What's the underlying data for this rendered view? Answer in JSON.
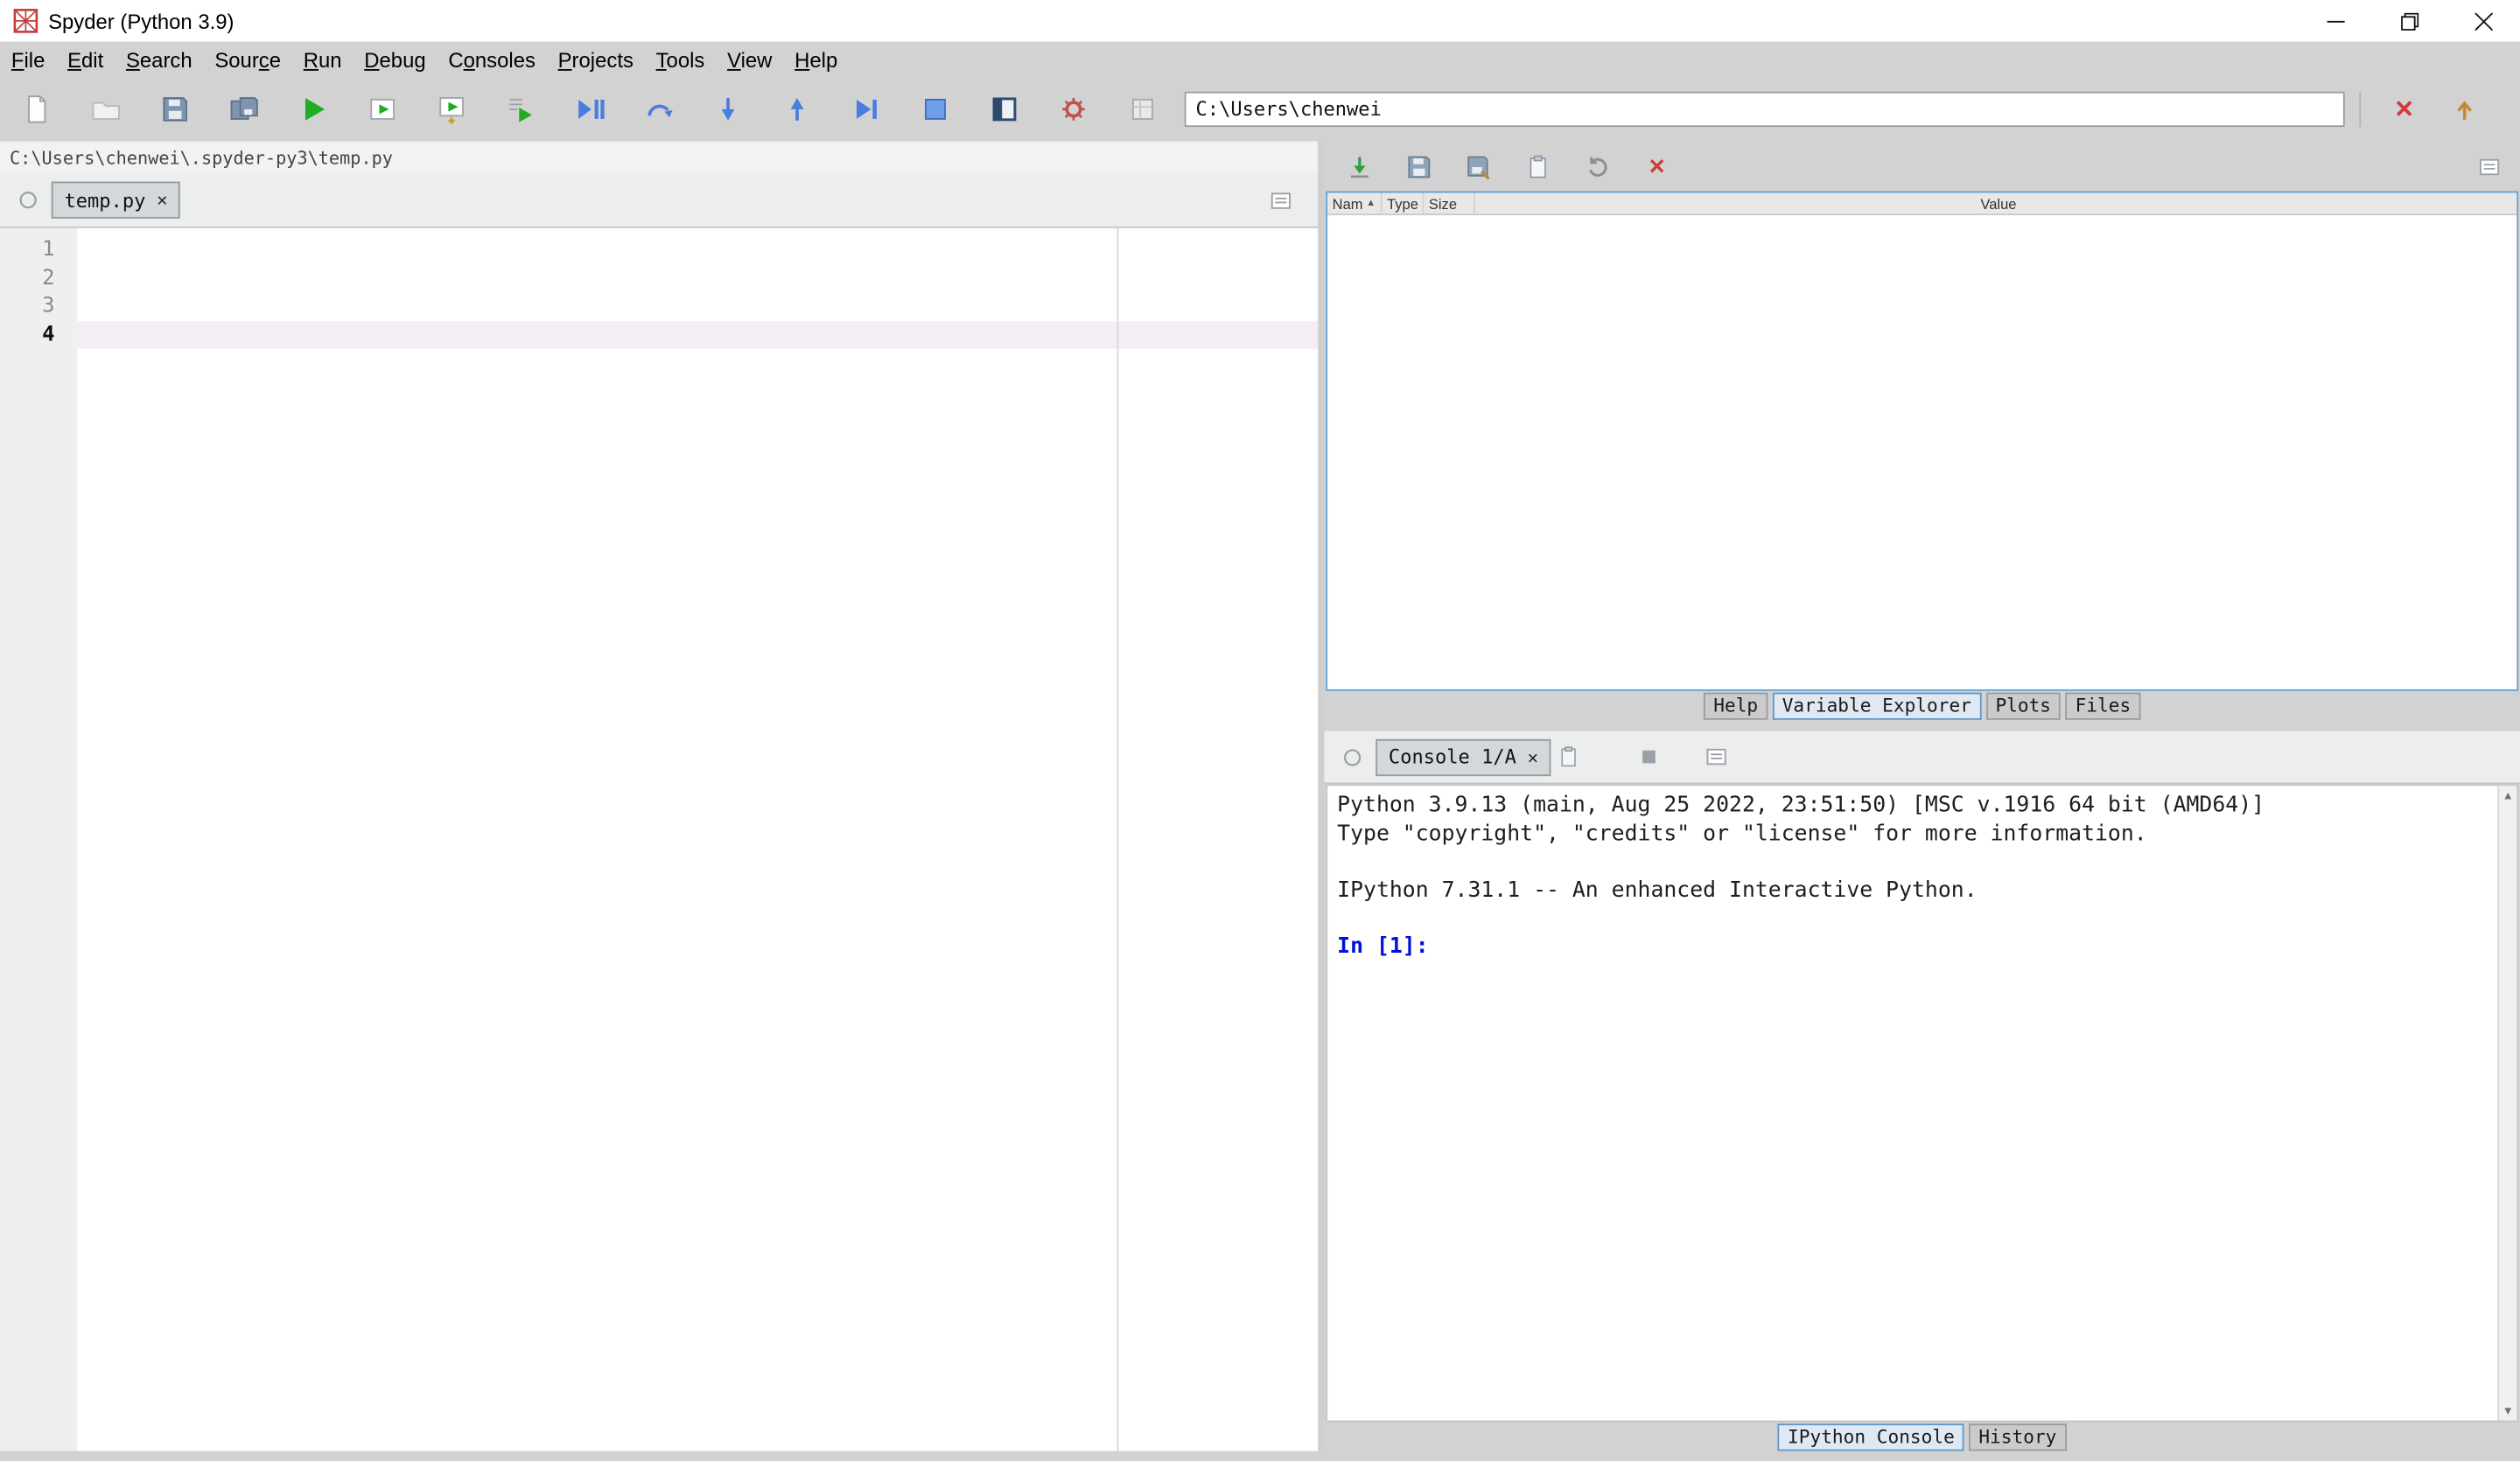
{
  "window": {
    "title": "Spyder (Python 3.9)"
  },
  "menu": {
    "items": [
      {
        "label": "&File"
      },
      {
        "label": "&Edit"
      },
      {
        "label": "&Search"
      },
      {
        "label": "Sour&ce"
      },
      {
        "label": "&Run"
      },
      {
        "label": "&Debug"
      },
      {
        "label": "C&onsoles"
      },
      {
        "label": "&Projects"
      },
      {
        "label": "&Tools"
      },
      {
        "label": "&View"
      },
      {
        "label": "&Help"
      }
    ]
  },
  "toolbar": {
    "working_directory": "C:\\Users\\chenwei",
    "icons": [
      "new-file-icon",
      "open-file-icon",
      "save-file-icon",
      "save-all-icon",
      "run-icon",
      "run-cell-icon",
      "run-cell-advance-icon",
      "run-selection-icon",
      "debug-icon",
      "step-over-icon",
      "step-into-icon",
      "step-out-icon",
      "continue-icon",
      "stop-icon",
      "maximize-pane-icon",
      "preferences-icon",
      "environment-icon",
      "browse-directory-icon",
      "parent-directory-icon"
    ]
  },
  "editor": {
    "breadcrumb": "C:\\Users\\chenwei\\.spyder-py3\\temp.py",
    "tab": {
      "label": "temp.py",
      "close_glyph": "✕"
    },
    "line_numbers": [
      "1",
      "2",
      "3",
      "4"
    ],
    "current_line": "4"
  },
  "variable_explorer": {
    "toolbar_icons": [
      "import-data-icon",
      "save-data-icon",
      "save-data-as-icon",
      "clipboard-icon",
      "refresh-icon",
      "remove-variable-icon",
      "options-menu-icon"
    ],
    "columns": {
      "name": "Nam",
      "sort_glyph": "▲",
      "type": "Type",
      "size": "Size",
      "value": "Value"
    },
    "tabs": [
      {
        "label": "Help",
        "selected": false
      },
      {
        "label": "Variable Explorer",
        "selected": true
      },
      {
        "label": "Plots",
        "selected": false
      },
      {
        "label": "Files",
        "selected": false
      }
    ]
  },
  "console": {
    "tab": {
      "label": "Console 1/A",
      "close_glyph": "✕"
    },
    "toolbar_icons": [
      "clipboard-icon",
      "interrupt-kernel-icon",
      "options-menu-icon"
    ],
    "lines": [
      "Python 3.9.13 (main, Aug 25 2022, 23:51:50) [MSC v.1916 64 bit (AMD64)]",
      "Type \"copyright\", \"credits\" or \"license\" for more information.",
      "",
      "IPython 7.31.1 -- An enhanced Interactive Python.",
      ""
    ],
    "prompt": "In [1]:",
    "tabs": [
      {
        "label": "IPython Console",
        "selected": true
      },
      {
        "label": "History",
        "selected": false
      }
    ]
  },
  "colors": {
    "window_chrome": "#d2d2d2",
    "titlebar_bg": "#ffffff",
    "focus_border_blue": "#5b9fd4",
    "run_green": "#21ac21",
    "debug_blue": "#4a7de0",
    "prompt_blue": "#0010d8",
    "current_line_pink": "#f6ecf6",
    "error_red": "#cf3b3b",
    "parent_dir_orange": "#c8872e"
  }
}
